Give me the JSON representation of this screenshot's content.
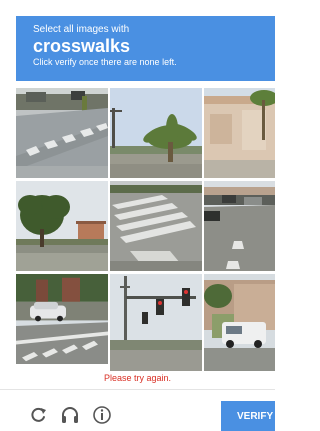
{
  "header": {
    "line1": "Select all images with",
    "target": "crosswalks",
    "line3": "Click verify once there are none left."
  },
  "tiles": [
    {
      "name": "tile-1",
      "scene": "street with crosswalk"
    },
    {
      "name": "tile-2",
      "scene": "palm tree"
    },
    {
      "name": "tile-3",
      "scene": "building with palm"
    },
    {
      "name": "tile-4",
      "scene": "tree by road"
    },
    {
      "name": "tile-5",
      "scene": "crosswalk stripes"
    },
    {
      "name": "tile-6",
      "scene": "road with cars"
    },
    {
      "name": "tile-7",
      "scene": "parked car and crosswalk"
    },
    {
      "name": "tile-8",
      "scene": "traffic lights"
    },
    {
      "name": "tile-9",
      "scene": "van by building"
    }
  ],
  "error_text": "Please try again.",
  "footer": {
    "reload_icon": "reload-icon",
    "audio_icon": "headphones-icon",
    "info_icon": "info-icon",
    "verify_label": "VERIFY"
  },
  "colors": {
    "accent": "#4a90e2",
    "error": "#d93025"
  }
}
